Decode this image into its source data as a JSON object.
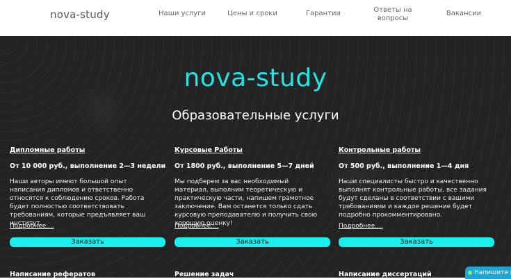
{
  "header": {
    "logo": "nova-study",
    "nav": [
      "Наши услуги",
      "Цены и сроки",
      "Гарантии",
      "Ответы на\nвопросы",
      "Вакансии"
    ]
  },
  "hero": {
    "brand": "nova-study",
    "section_title": "Образовательные услуги"
  },
  "cards": [
    {
      "title": "Дипломные работы",
      "price": "От 10 000 руб., выполнение 2—3 недели",
      "desc": "Наши авторы имеют большой опыт написания дипломов и ответственно относятся к соблюдению сроков. Работа будет полностью соответствовать требованиям, которые предъявляет ваш институт.",
      "more": "Подробнее....",
      "button": "Заказать"
    },
    {
      "title": "Курсовые Работы",
      "price": "От 1800 руб., выполнение 5—7 дней",
      "desc": "Мы подберем за вас необходимый материал, выполним теоретическую и практическую части, напишем грамотное заключение. Вам останется только сдать курсовую преподавателю и получить свою хорошую оценку!",
      "more": "Подробнее....",
      "button": "Заказать"
    },
    {
      "title": "Контрольные работы",
      "price": "От 500 руб., выполнение 1—4 дня",
      "desc": "Наши специалисты быстро и качественно выполнят контрольные работы, все задания будут сделаны в соответствии с вашими требованиями и каждое решение будет подробно прокомментировано.",
      "more": "Подробнее....",
      "button": "Заказать"
    }
  ],
  "cards_next": [
    "Написание рефератов",
    "Решение задач",
    "Написание диссертаций"
  ],
  "chat": {
    "label": "Напишите н"
  },
  "colors": {
    "accent": "#19f0ee",
    "brand": "#22e6e6",
    "background": "#232323"
  }
}
